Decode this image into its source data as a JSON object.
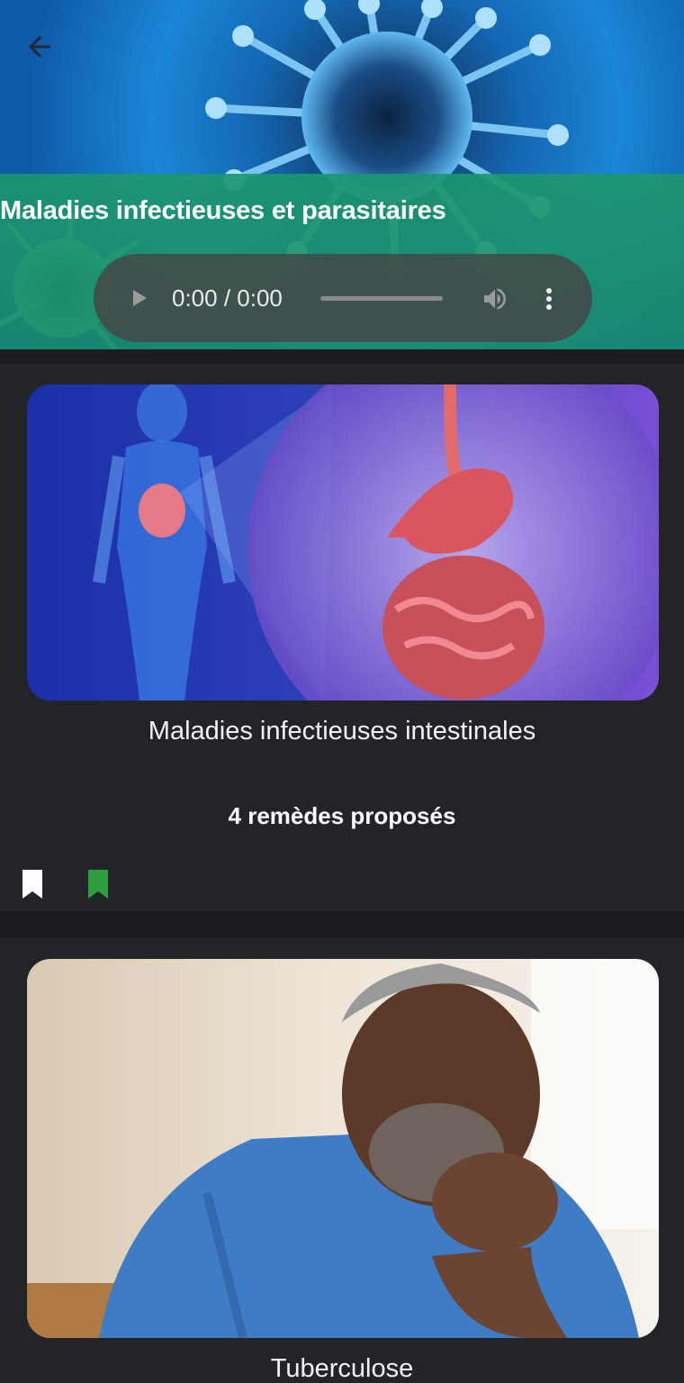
{
  "header": {
    "title": "Maladies infectieuses et parasitaires",
    "back_icon": "arrow-left-icon"
  },
  "audio": {
    "time": "0:00 / 0:00",
    "progress": 0,
    "play_icon": "play-icon",
    "volume_icon": "volume-icon",
    "more_icon": "more-vertical-icon"
  },
  "cards": [
    {
      "title": "Maladies infectieuses intestinales",
      "remedies": "4 remèdes proposés",
      "bookmark_colors": [
        "#ffffff",
        "#2e9d3e"
      ]
    },
    {
      "title": "Tuberculose"
    }
  ],
  "colors": {
    "accent_green": "#1c966e",
    "card_bg": "#232428",
    "page_bg": "#1a1c1f"
  }
}
